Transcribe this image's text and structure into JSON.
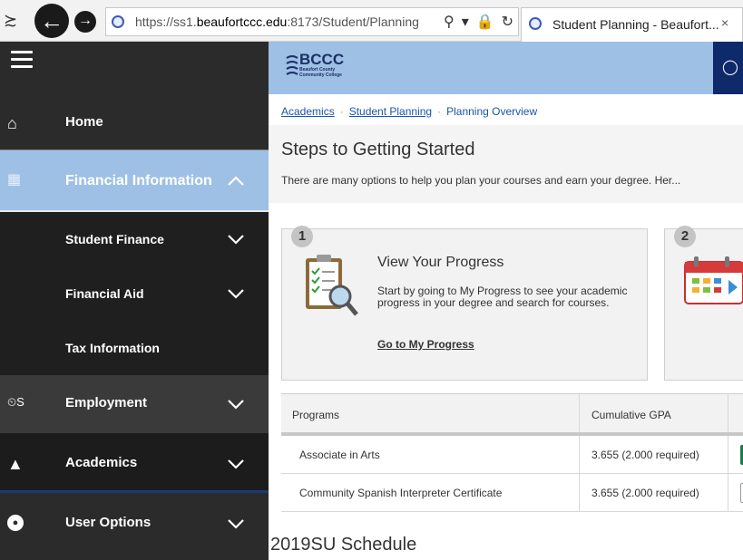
{
  "browser": {
    "nav_glyph": "≿",
    "back_icon": "back-arrow-icon",
    "forward_icon": "forward-arrow-icon",
    "url_prefix": "https://ss1.",
    "url_domain": "beaufortccc.edu",
    "url_path": ":8173/Student/Planning",
    "tab_title": "Student Planning - Beaufort...",
    "tab_close": "×"
  },
  "sidebar": {
    "items": [
      {
        "label": "Home",
        "icon": "home-icon"
      },
      {
        "label": "Financial Information",
        "icon": "bank-icon",
        "expanded": true
      },
      {
        "label": "Student Finance"
      },
      {
        "label": "Financial Aid"
      },
      {
        "label": "Tax Information"
      },
      {
        "label": "Employment",
        "icon": "timecard-icon",
        "icon_text": "⏲S"
      },
      {
        "label": "Academics",
        "icon": "graduation-cap-icon"
      },
      {
        "label": "User Options",
        "icon": "user-icon"
      }
    ],
    "accent": "#9ec0e4"
  },
  "header": {
    "logo_text": "BCCC",
    "logo_sub": "Beaufort County Community College",
    "brand_color": "#9ec0e4",
    "user_strip_color": "#0f2a6b"
  },
  "breadcrumb": [
    "Academics",
    "Student Planning",
    "Planning Overview"
  ],
  "main": {
    "title": "Steps to Getting Started",
    "subtitle": "There are many options to help you plan your courses and earn your degree. Her...",
    "cards": [
      {
        "number": "1",
        "title": "View Your Progress",
        "description": "Start by going to My Progress to see your academic progress in your degree and search for courses.",
        "link": "Go to My Progress"
      },
      {
        "number": "2"
      }
    ],
    "table": {
      "headers": [
        "Programs",
        "Cumulative GPA"
      ],
      "rows": [
        {
          "program": "Associate in Arts",
          "gpa": "3.655 (2.000 required)",
          "bar": "green"
        },
        {
          "program": "Community Spanish Interpreter Certificate",
          "gpa": "3.655 (2.000 required)",
          "bar": "empty"
        }
      ]
    },
    "schedule_heading": "2019SU Schedule"
  }
}
